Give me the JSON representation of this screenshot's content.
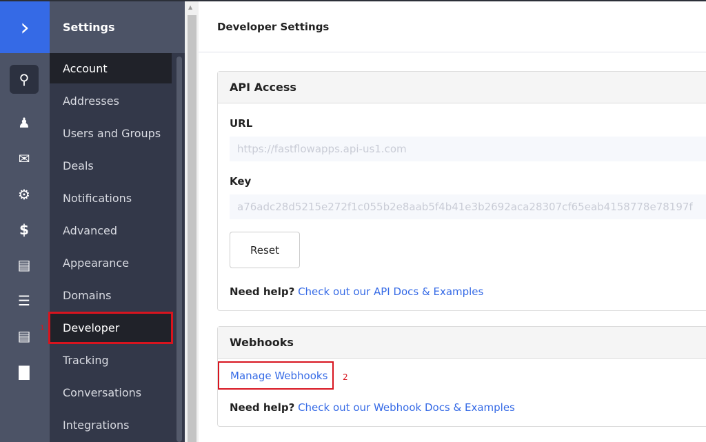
{
  "rail": {
    "icons": [
      "logo-chevron-icon",
      "search-icon",
      "contacts-icon",
      "email-icon",
      "automations-icon",
      "deals-dollar-icon",
      "conversations-icon",
      "lists-icon",
      "forms-icon",
      "reports-icon"
    ]
  },
  "nav": {
    "title": "Settings",
    "items": [
      "Account",
      "Addresses",
      "Users and Groups",
      "Deals",
      "Notifications",
      "Advanced",
      "Appearance",
      "Domains",
      "Developer",
      "Tracking",
      "Conversations",
      "Integrations"
    ],
    "active": "Developer"
  },
  "annotations": {
    "one": "1",
    "two": "2"
  },
  "page": {
    "title": "Developer Settings"
  },
  "api": {
    "title": "API Access",
    "url_label": "URL",
    "url_value": "https://fastflowapps.api-us1.com",
    "key_label": "Key",
    "key_value": "a76adc28d5215e272f1c055b2e8aab5f4b41e3b2692aca28307cf65eab4158778e78197f",
    "reset": "Reset",
    "help_prefix": "Need help?",
    "help_link": "Check out our API Docs & Examples"
  },
  "webhooks": {
    "title": "Webhooks",
    "manage": "Manage Webhooks",
    "help_prefix": "Need help?",
    "help_link": "Check out our Webhook Docs & Examples"
  },
  "colors": {
    "brand": "#356ae6",
    "highlight": "#d8141e"
  }
}
